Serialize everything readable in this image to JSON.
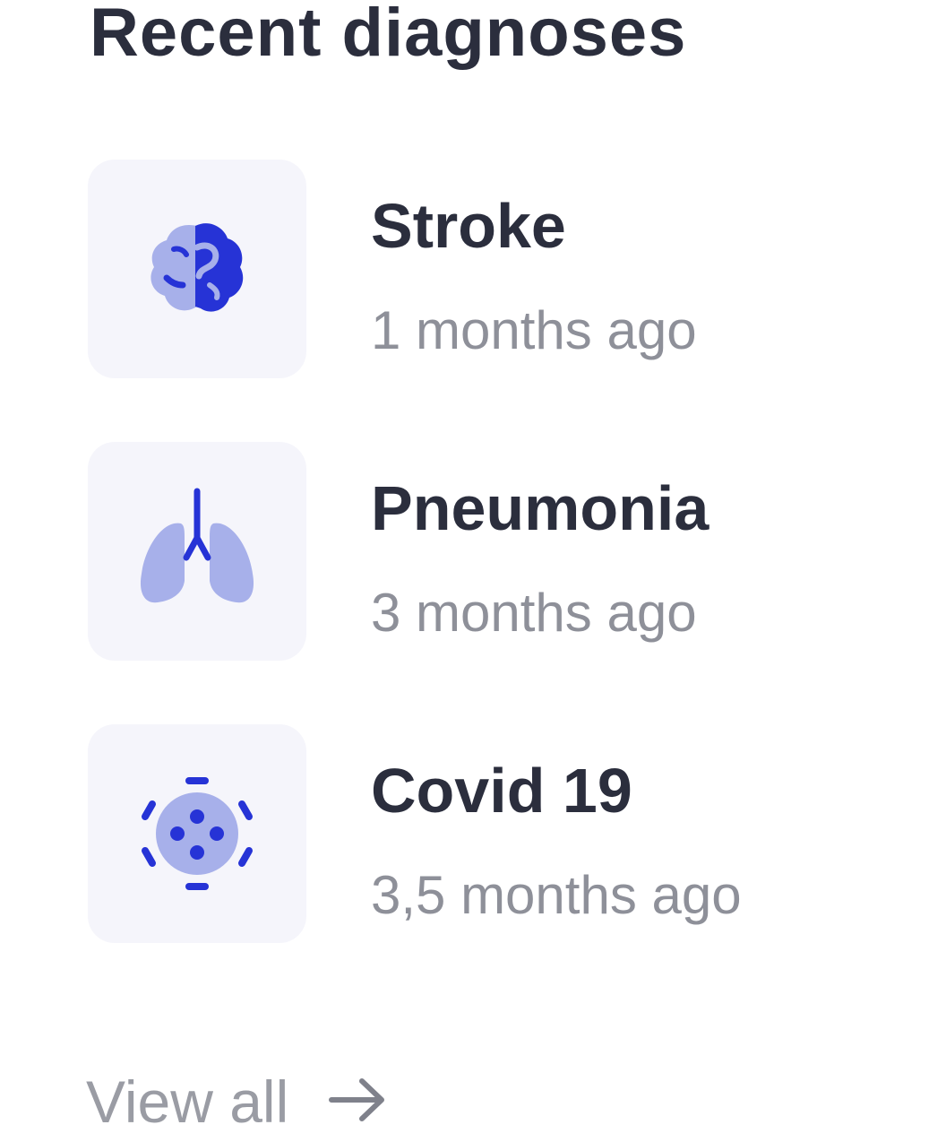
{
  "panel": {
    "title": "Recent diagnoses",
    "view_all_label": "View all"
  },
  "diagnoses": [
    {
      "name": "Stroke",
      "time": "1 months ago",
      "icon": "brain-icon"
    },
    {
      "name": "Pneumonia",
      "time": "3 months ago",
      "icon": "lungs-icon"
    },
    {
      "name": "Covid 19",
      "time": "3,5 months ago",
      "icon": "virus-icon"
    }
  ],
  "colors": {
    "accent": "#2633d6",
    "accent_light": "#a7b0ea",
    "tile_background": "#f5f5fb",
    "title_text": "#2b2e3d",
    "muted_text": "#8e9099"
  }
}
